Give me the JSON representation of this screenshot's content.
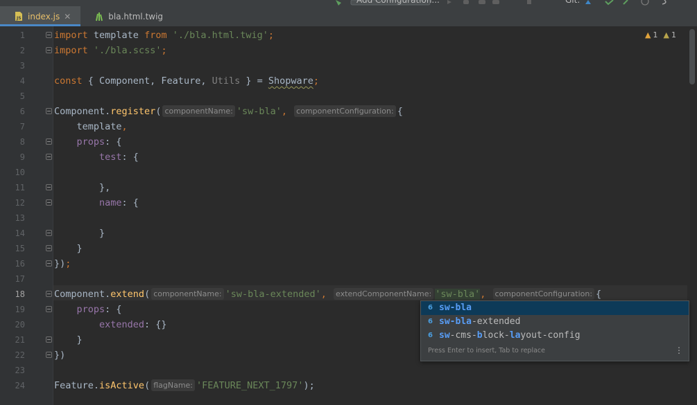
{
  "toolbar": {
    "run_config_label": "Add Configuration...",
    "git_label": "Git:",
    "icons": [
      "hammer-icon",
      "run-config-dropdown",
      "run-icon",
      "debug-icon",
      "coverage-icon",
      "profile-icon",
      "stop-icon",
      "git-update-icon",
      "git-commit-icon",
      "git-push-icon",
      "history-icon",
      "rollback-icon"
    ]
  },
  "tabs": [
    {
      "label": "index.js",
      "icon": "js-file-icon",
      "active": true,
      "closable": true
    },
    {
      "label": "bla.html.twig",
      "icon": "twig-file-icon",
      "active": false,
      "closable": false
    }
  ],
  "inspections": {
    "warnings": "1",
    "weak_warnings": "1"
  },
  "colors": {
    "keyword": "#cc7832",
    "string": "#6a8759",
    "function": "#ffc66d",
    "property": "#9876aa",
    "selection": "#0d3a58",
    "tab_underline": "#4a88c7"
  },
  "editor": {
    "current_line": "18",
    "lines": {
      "l1": {
        "num": "1",
        "t1": "import",
        "t2": " template ",
        "t3": "from",
        "t4": " ",
        "t5": "'./bla.html.twig'",
        "t6": ";"
      },
      "l2": {
        "num": "2",
        "t1": "import",
        "t2": " ",
        "t3": "'./bla.scss'",
        "t4": ";"
      },
      "l3": {
        "num": "3"
      },
      "l4": {
        "num": "4",
        "t1": "const",
        "t2": " { Component, Feature, ",
        "t3": "Utils",
        "t4": " } = ",
        "t5": "Shopware",
        "t6": ";"
      },
      "l5": {
        "num": "5"
      },
      "l6": {
        "num": "6",
        "t1": "Component.",
        "t2": "register",
        "t3": "(",
        "h1": "componentName:",
        "t4": "'sw-bla'",
        "t5": ",",
        "h2": "componentConfiguration:",
        "t6": "{"
      },
      "l7": {
        "num": "7",
        "t1": "    template",
        "t2": ","
      },
      "l8": {
        "num": "8",
        "t1": "    props",
        "t2": ": {"
      },
      "l9": {
        "num": "9",
        "t1": "        test",
        "t2": ": {"
      },
      "l10": {
        "num": "10"
      },
      "l11": {
        "num": "11",
        "t1": "        },",
        "t2": ""
      },
      "l12": {
        "num": "12",
        "t1": "        name",
        "t2": ": {"
      },
      "l13": {
        "num": "13"
      },
      "l14": {
        "num": "14",
        "t1": "        }"
      },
      "l15": {
        "num": "15",
        "t1": "    }"
      },
      "l16": {
        "num": "16",
        "t1": "})",
        "t2": ";"
      },
      "l17": {
        "num": "17"
      },
      "l18": {
        "num": "18",
        "t1": "Component.",
        "t2": "extend",
        "t3": "(",
        "h1": "componentName:",
        "t4": "'sw-bla-extended'",
        "t5": ",",
        "h2": "extendComponentName:",
        "t6": "'sw-bla'",
        "t7": ",",
        "h3": "componentConfiguration:",
        "t8": "{"
      },
      "l19": {
        "num": "19",
        "t1": "    props",
        "t2": ": {"
      },
      "l20": {
        "num": "20",
        "t1": "        extended",
        "t2": ": {}"
      },
      "l21": {
        "num": "21",
        "t1": "    }"
      },
      "l22": {
        "num": "22",
        "t1": "})"
      },
      "l23": {
        "num": "23"
      },
      "l24": {
        "num": "24",
        "t1": "Feature.",
        "t2": "isActive",
        "t3": "(",
        "h1": "flagName:",
        "t4": "'FEATURE_NEXT_1797'",
        "t5": ");"
      }
    }
  },
  "autocomplete": {
    "items": [
      {
        "icon": "6",
        "parts": [
          "sw-bla",
          "",
          ""
        ]
      },
      {
        "icon": "6",
        "parts": [
          "sw-bla",
          "-extended",
          ""
        ]
      },
      {
        "icon": "6",
        "parts": [
          "sw",
          "-cms-",
          "b",
          "lock-",
          "la",
          "yout-config"
        ]
      }
    ],
    "footer": "Press Enter to insert, Tab to replace",
    "menu_glyph": "⋮"
  }
}
